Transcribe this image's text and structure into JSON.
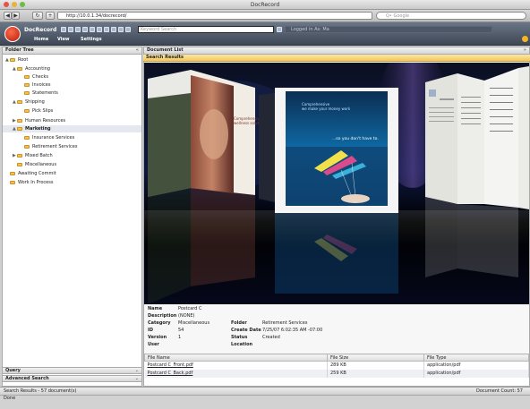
{
  "browser": {
    "window_title": "DocRecord",
    "back": "◀",
    "forward": "▶",
    "reload": "↻",
    "add": "+",
    "url": "http://10.0.1.34/docrecord/",
    "search_placeholder": "Q• Google"
  },
  "app": {
    "name": "DocRecord",
    "keyword_placeholder": "Keyword Search",
    "logged_in": "Logged in As: Ma",
    "menu": [
      "Home",
      "View",
      "Settings"
    ]
  },
  "folder_tree": {
    "header": "Folder Tree",
    "items": [
      {
        "label": "Root",
        "toggle": "▲"
      },
      {
        "label": "Accounting",
        "toggle": "▲"
      },
      {
        "label": "Checks",
        "toggle": ""
      },
      {
        "label": "Invoices",
        "toggle": ""
      },
      {
        "label": "Statements",
        "toggle": ""
      },
      {
        "label": "Shipping",
        "toggle": "▲"
      },
      {
        "label": "Pick Slips",
        "toggle": ""
      },
      {
        "label": "Human Resources",
        "toggle": "▶"
      },
      {
        "label": "Marketing",
        "toggle": "▲"
      },
      {
        "label": "Insurance Services",
        "toggle": ""
      },
      {
        "label": "Retirement Services",
        "toggle": ""
      },
      {
        "label": "Mixed Batch",
        "toggle": "▶"
      },
      {
        "label": "Miscellaneous",
        "toggle": ""
      },
      {
        "label": "Awaiting Commit",
        "toggle": ""
      },
      {
        "label": "Work In Process",
        "toggle": ""
      }
    ],
    "query": "Query",
    "advanced_search": "Advanced Search"
  },
  "document_list": {
    "header": "Document List",
    "results_header": "Search Results",
    "flow_pages": [
      {
        "lines": [
          "Comprehensive",
          "wellness solutions"
        ]
      },
      {
        "lines": [
          "Comprehensive",
          "wellness solutions"
        ]
      },
      {
        "lines": [
          "Comprehensive",
          "we make your money work",
          "...so you don't have to."
        ]
      }
    ]
  },
  "properties": {
    "left": [
      {
        "label": "Name",
        "value": "Postcard C"
      },
      {
        "label": "Description",
        "value": "(NONE)"
      },
      {
        "label": "Category",
        "value": "Miscellaneous"
      },
      {
        "label": "ID",
        "value": "54"
      },
      {
        "label": "Version",
        "value": "1"
      },
      {
        "label": "User",
        "value": ""
      }
    ],
    "right": [
      {
        "label": "Folder",
        "value": "Retirement Services"
      },
      {
        "label": "Create Date",
        "value": "7/25/07 6:02:35 AM -07:00"
      },
      {
        "label": "Status",
        "value": "Created"
      },
      {
        "label": "Location",
        "value": ""
      }
    ]
  },
  "files": {
    "columns": [
      "File Name",
      "File Size",
      "File Type"
    ],
    "rows": [
      {
        "name": "Postcard C_Front.pdf",
        "size": "289 KB",
        "type": "application/pdf"
      },
      {
        "name": "Postcard C_Back.pdf",
        "size": "259 KB",
        "type": "application/pdf"
      }
    ]
  },
  "status": {
    "left": "Search Results - 57 document(s)",
    "right": "Document Count: 57",
    "browser": "Done"
  },
  "colors": {
    "results_bar": "#f4c75b",
    "app_header": "#4d5768",
    "logo": "#d9341a",
    "flow_background": "#0d1740"
  }
}
